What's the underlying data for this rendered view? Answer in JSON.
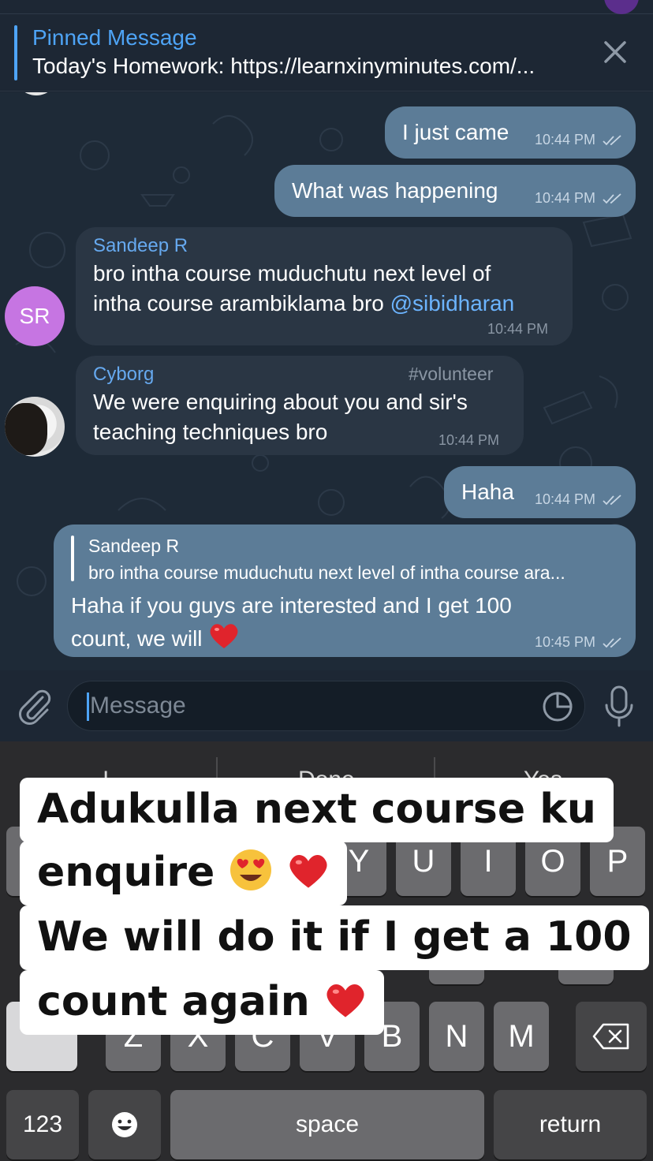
{
  "header": {
    "pinned_title": "Pinned Message",
    "pinned_text": "Today's Homework: https://learnxinyminutes.com/..."
  },
  "messages": [
    {
      "dir": "out",
      "text": "I just came",
      "time": "10:44 PM"
    },
    {
      "dir": "out",
      "text": "What was happening",
      "time": "10:44 PM"
    },
    {
      "dir": "in",
      "sender": "Sandeep R",
      "line1": "bro intha course muduchutu next level of",
      "line2": "intha course arambiklama bro ",
      "mention": "@sibidharan",
      "time": "10:44 PM",
      "avatar_initials": "SR"
    },
    {
      "dir": "in",
      "sender": "Cyborg",
      "tag": "#volunteer",
      "line1": "We were enquiring about you and sir's",
      "line2": "teaching techniques bro",
      "time": "10:44 PM"
    },
    {
      "dir": "out",
      "text": "Haha",
      "time": "10:44 PM"
    },
    {
      "dir": "out",
      "reply_name": "Sandeep R",
      "reply_text": "bro intha course muduchutu next level of intha course ara...",
      "line1": "Haha if you guys are interested and I get 100",
      "line2": "count, we will",
      "time": "10:45 PM"
    }
  ],
  "input": {
    "placeholder": "Message"
  },
  "keyboard": {
    "suggestions": [
      "I",
      "Done",
      "Yes"
    ],
    "row1_visible": [
      "Y",
      "U",
      "I",
      "O",
      "P"
    ],
    "row3_visible": [
      "Z",
      "X",
      "C",
      "V",
      "B",
      "N",
      "M"
    ],
    "numbers_key": "123",
    "space_key": "space",
    "return_key": "return"
  },
  "caption": {
    "line1": "Adukulla next course ku",
    "line2": "enquire",
    "line3": "We will do it if I get a 100",
    "line4": "count again"
  },
  "colors": {
    "accent": "#4ea4f6",
    "outgoing_bubble": "#5c7c97",
    "incoming_bubble": "#2a3644",
    "chat_bg": "#1e2a37"
  }
}
